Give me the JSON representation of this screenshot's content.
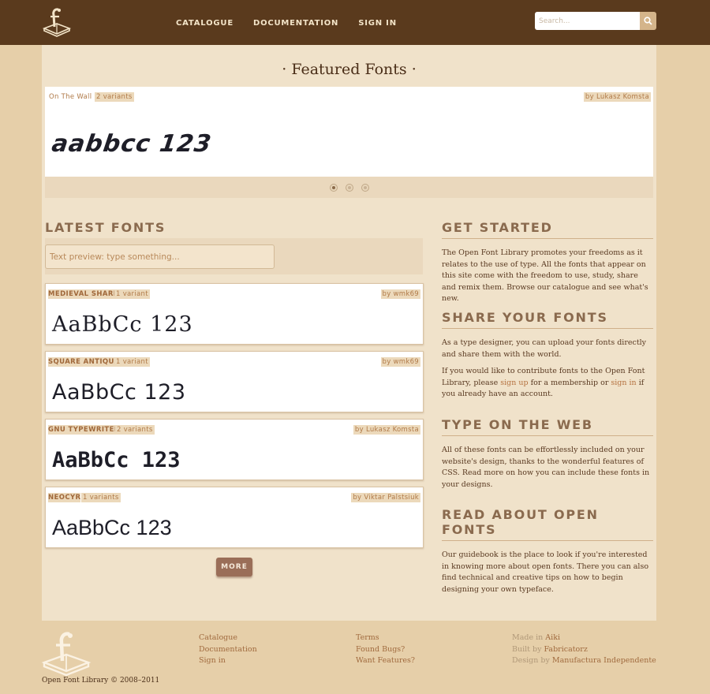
{
  "header": {
    "nav": [
      "CATALOGUE",
      "DOCUMENTATION",
      "SIGN IN"
    ],
    "search_placeholder": "Search...",
    "colors": {
      "bar": "#5a3a1d",
      "search_button": "#d4b48a"
    }
  },
  "featured": {
    "title": "· Featured Fonts ·",
    "font_name": "On The Wall",
    "variants": "2 variants",
    "author": "by Lukasz Komsta",
    "sample": "aabbcc 123",
    "dots": 3,
    "active_dot": 1
  },
  "latest": {
    "heading": "LATEST FONTS",
    "preview_placeholder": "Text preview: type something...",
    "fonts": [
      {
        "name": "MEDIEVAL SHARP",
        "variants": "1 variant",
        "author": "by wmk69",
        "sample": "AaBbCc 123"
      },
      {
        "name": "SQUARE ANTIQUA",
        "variants": "1 variant",
        "author": "by wmk69",
        "sample": "AaBbCc 123"
      },
      {
        "name": "GNU TYPEWRITER",
        "variants": "2 variants",
        "author": "by Lukasz Komsta",
        "sample": "AaBbCc 123"
      },
      {
        "name": "NEOCYR",
        "variants": "1 variants",
        "author": "by Viktar Palstsiuk",
        "sample": "AaBbCc 123"
      }
    ],
    "more_label": "MORE"
  },
  "sidebar": {
    "get_started": {
      "heading": "GET STARTED",
      "text": "The Open Font Library promotes your freedoms as it relates to the use of type. All the fonts that appear on this site come with the freedom to use, study, share and remix them. Browse our catalogue and see what's new."
    },
    "share": {
      "heading": "SHARE YOUR FONTS",
      "text1": "As a type designer, you can upload your fonts directly and share them with the world.",
      "text2_a": "If you would like to contribute fonts to the Open Font Library, please ",
      "sign_up": "sign up",
      "text2_b": " for a membership or ",
      "sign_in": "sign in",
      "text2_c": " if you already have an account."
    },
    "web": {
      "heading": "TYPE ON THE WEB",
      "text": "All of these fonts can be effortlessly included on your website's design, thanks to the wonderful features of CSS. Read more on how you can include these fonts in your designs."
    },
    "read": {
      "heading": "READ ABOUT OPEN FONTS",
      "text": "Our guidebook is the place to look if you're interested in knowing more about open fonts. There you can also find technical and creative tips on how to begin designing your own typeface."
    }
  },
  "footer": {
    "col1": [
      "Catalogue",
      "Documentation",
      "Sign in"
    ],
    "col2": [
      "Terms",
      "Found Bugs?",
      "Want Features?"
    ],
    "credits": [
      {
        "prefix": "Made in ",
        "link": "Aiki"
      },
      {
        "prefix": "Built by ",
        "link": "Fabricatorz"
      },
      {
        "prefix": "Design by ",
        "link": "Manufactura Independente"
      }
    ],
    "copyright": "Open Font Library © 2008–2011"
  }
}
